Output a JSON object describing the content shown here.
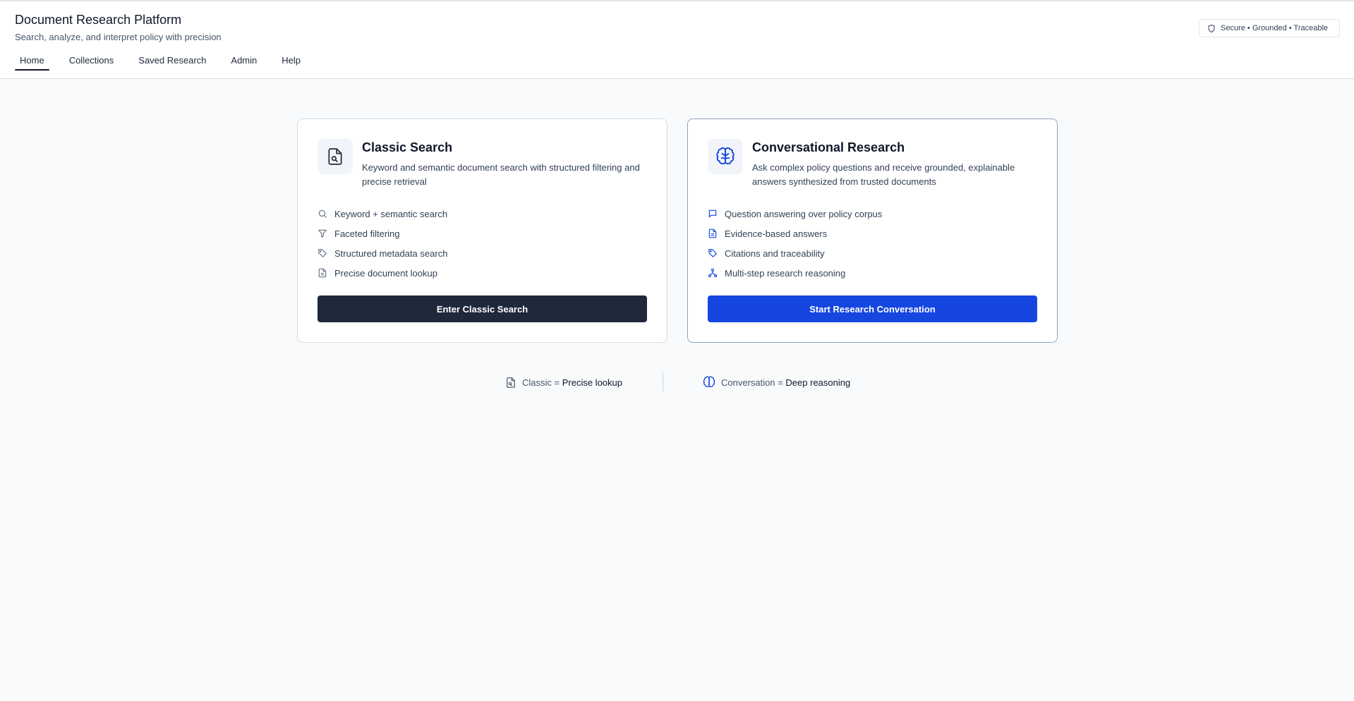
{
  "header": {
    "title": "Document Research Platform",
    "subtitle": "Search, analyze, and interpret policy with precision",
    "badge": {
      "icon": "shield-icon",
      "label": "Secure • Grounded • Traceable"
    }
  },
  "nav": {
    "items": [
      {
        "label": "Home",
        "active": true
      },
      {
        "label": "Collections",
        "active": false
      },
      {
        "label": "Saved Research",
        "active": false
      },
      {
        "label": "Admin",
        "active": false
      },
      {
        "label": "Help",
        "active": false
      }
    ]
  },
  "cards": {
    "classic": {
      "icon": "document-search-icon",
      "title": "Classic Search",
      "description": "Keyword and semantic document search with structured filtering and precise retrieval",
      "features": [
        {
          "icon": "search-icon",
          "label": "Keyword + semantic search"
        },
        {
          "icon": "filter-icon",
          "label": "Faceted filtering"
        },
        {
          "icon": "tag-icon",
          "label": "Structured metadata search"
        },
        {
          "icon": "document-icon",
          "label": "Precise document lookup"
        }
      ],
      "button_label": "Enter Classic Search"
    },
    "conversational": {
      "icon": "brain-icon",
      "title": "Conversational Research",
      "description": "Ask complex policy questions and receive grounded, explainable answers synthesized from trusted documents",
      "features": [
        {
          "icon": "chat-bubble-icon",
          "label": "Question answering over policy corpus"
        },
        {
          "icon": "document-icon",
          "label": "Evidence-based answers"
        },
        {
          "icon": "tag-icon",
          "label": "Citations and traceability"
        },
        {
          "icon": "network-icon",
          "label": "Multi-step research reasoning"
        }
      ],
      "button_label": "Start Research Conversation"
    }
  },
  "legend": {
    "classic": {
      "prefix": "Classic = ",
      "emphasis": "Precise lookup"
    },
    "conversation": {
      "prefix": "Conversation = ",
      "emphasis": "Deep reasoning"
    }
  },
  "colors": {
    "accent_blue": "#1546e0",
    "dark_button": "#1e293b",
    "page_background": "#f8fafc"
  }
}
